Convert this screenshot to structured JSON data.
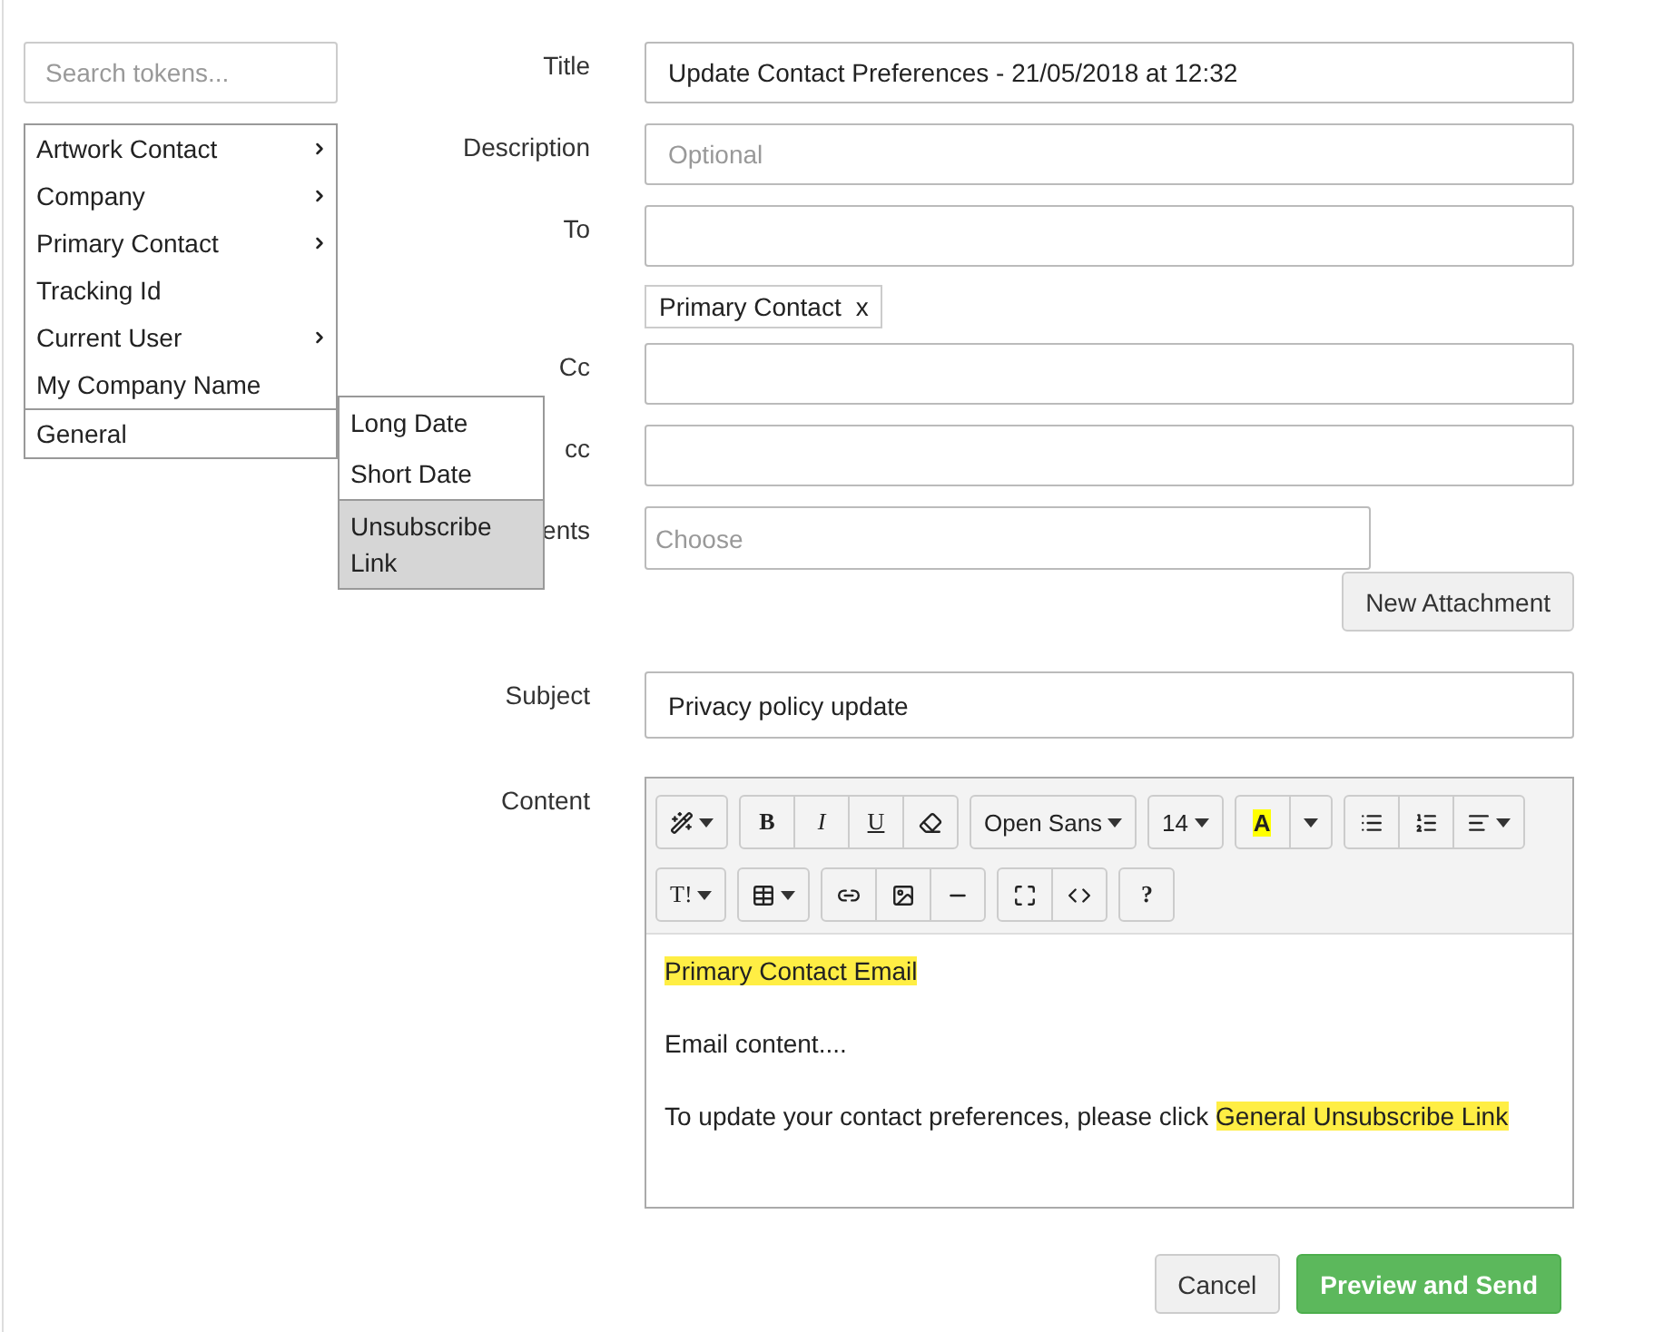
{
  "token_search": {
    "placeholder": "Search tokens..."
  },
  "token_menu": [
    {
      "label": "Artwork Contact",
      "has_submenu": true,
      "expanded": false
    },
    {
      "label": "Company",
      "has_submenu": true,
      "expanded": false
    },
    {
      "label": "Primary Contact",
      "has_submenu": true,
      "expanded": false
    },
    {
      "label": "Tracking Id",
      "has_submenu": false,
      "expanded": false
    },
    {
      "label": "Current User",
      "has_submenu": true,
      "expanded": false
    },
    {
      "label": "My Company Name",
      "has_submenu": false,
      "expanded": false
    },
    {
      "label": "General",
      "has_submenu": false,
      "expanded": true
    }
  ],
  "token_submenu": [
    {
      "label": "Long Date",
      "selected": false
    },
    {
      "label": "Short Date",
      "selected": false
    },
    {
      "label": "Unsubscribe Link",
      "selected": true
    }
  ],
  "fields": [
    {
      "kind": "input",
      "label": "Title",
      "value": "Update Contact Preferences - 21/05/2018 at 12:32"
    },
    {
      "kind": "input",
      "label": "Description",
      "placeholder": "Optional"
    },
    {
      "kind": "tags",
      "label": "To",
      "tags": [
        {
          "label": "Primary Contact",
          "remove": "x"
        }
      ]
    },
    {
      "kind": "input",
      "label": "Cc"
    },
    {
      "kind": "input",
      "label": "cc"
    },
    {
      "kind": "file",
      "label": "ents",
      "placeholder": "Choose",
      "button": "New Attachment"
    },
    {
      "kind": "input",
      "label": "Subject",
      "value": "Privacy policy update"
    },
    {
      "kind": "editor",
      "label": "Content"
    }
  ],
  "editor": {
    "toolbar_labels": [
      "B",
      "I",
      "U",
      "Open Sans",
      "14",
      "A",
      "T!",
      "?"
    ],
    "paragraphs": [
      [
        {
          "text": " Primary Contact Email",
          "highlight": true
        }
      ],
      [
        {
          "text": "Email content....",
          "highlight": false
        }
      ],
      [
        {
          "text": "To update your contact preferences, please click  ",
          "highlight": false
        },
        {
          "text": "General Unsubscribe Link",
          "highlight": true
        }
      ]
    ]
  },
  "actions": [
    {
      "label": "Cancel",
      "kind": "default"
    },
    {
      "label": "Preview and Send",
      "kind": "primary"
    }
  ]
}
